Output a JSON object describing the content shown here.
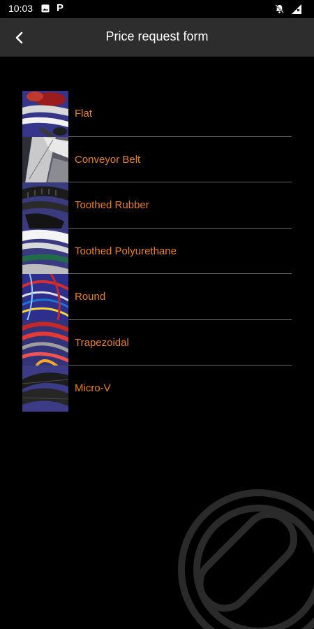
{
  "status_bar": {
    "time": "10:03",
    "icons": [
      "image-icon",
      "p-icon",
      "bell-off-icon",
      "signal-icon"
    ]
  },
  "app_bar": {
    "title": "Price request form",
    "back_icon": "chevron-left-icon"
  },
  "colors": {
    "background": "#000000",
    "app_bar": "#2d2d2d",
    "accent": "#e8822a",
    "divider": "#666666"
  },
  "belt_types": [
    {
      "label": "Flat"
    },
    {
      "label": "Conveyor Belt"
    },
    {
      "label": "Toothed Rubber"
    },
    {
      "label": "Toothed Polyurethane"
    },
    {
      "label": "Round"
    },
    {
      "label": "Trapezoidal"
    },
    {
      "label": "Micro-V"
    }
  ]
}
